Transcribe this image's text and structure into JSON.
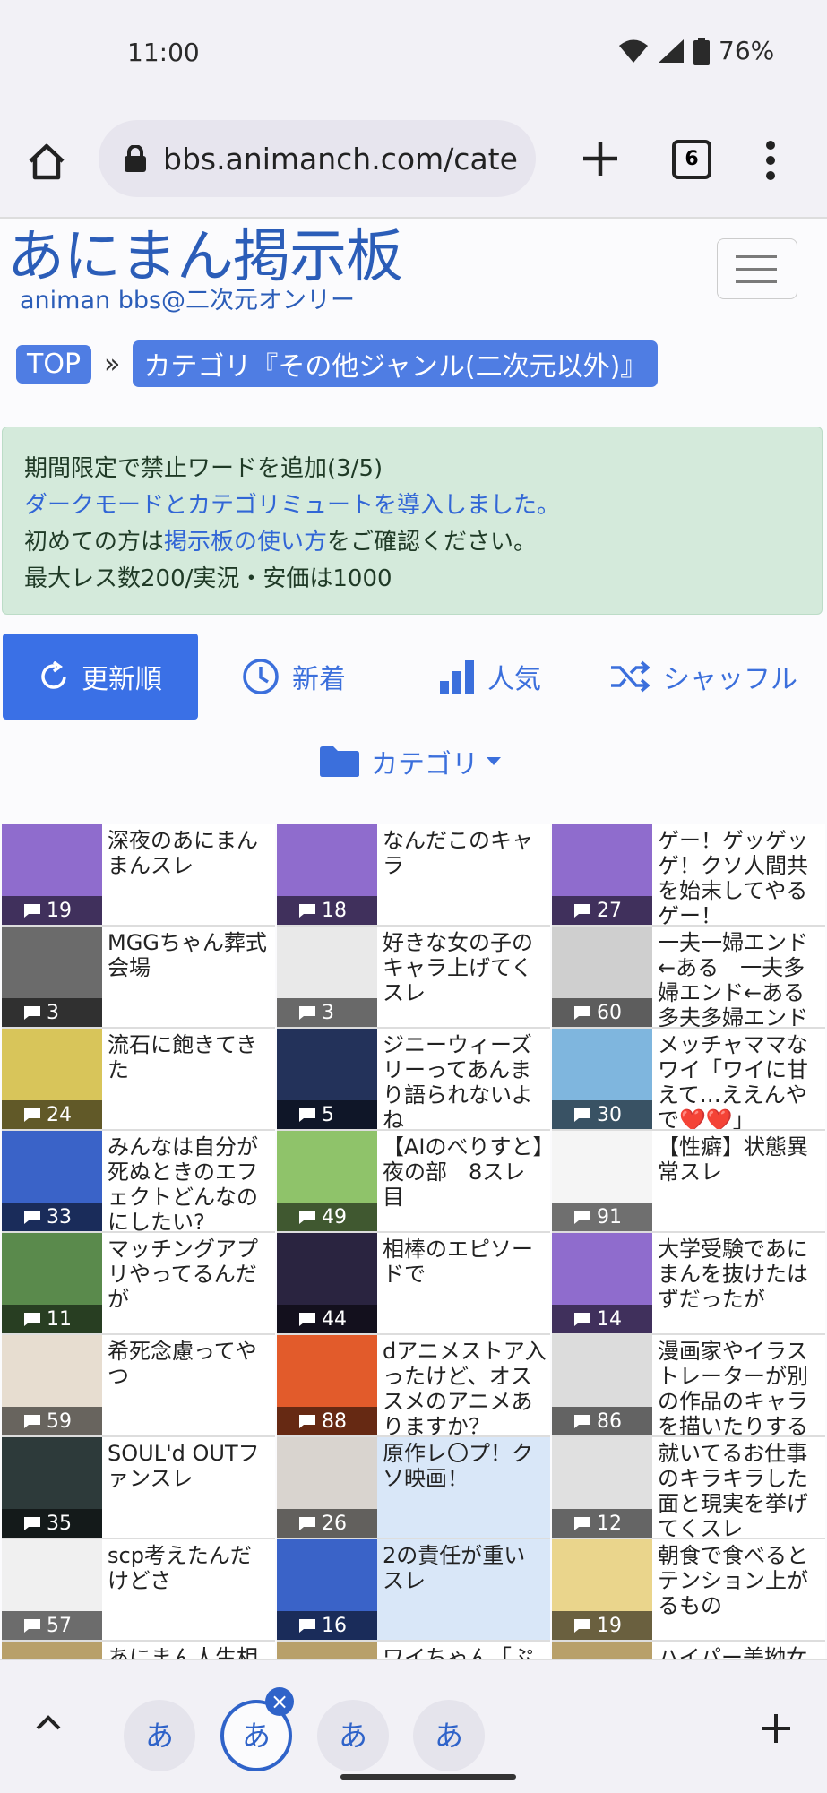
{
  "status": {
    "time": "11:00",
    "battery": "76%"
  },
  "browser": {
    "url": "bbs.animanch.com/cate",
    "tab_count": "6"
  },
  "site": {
    "logo_title": "あにまん掲示板",
    "logo_sub": "animan bbs@二次元オンリー"
  },
  "breadcrumb": {
    "top": "TOP",
    "sep": "»",
    "category": "カテゴリ『その他ジャンル(二次元以外)』"
  },
  "notice": {
    "line1": "期間限定で禁止ワードを追加(3/5)",
    "line2": "ダークモードとカテゴリミュートを導入しました。",
    "line3_pre": "初めての方は",
    "line3_link": "掲示板の使い方",
    "line3_post": "をご確認ください。",
    "line4": "最大レス数200/実況・安価は1000"
  },
  "sort_tabs": {
    "updated": "更新順",
    "new": "新着",
    "popular": "人気",
    "shuffle": "シャッフル"
  },
  "category_button": "カテゴリ",
  "threads": [
    {
      "title": "深夜のあにまんまんスレ",
      "count": "19",
      "thumb": "#8f6ccd"
    },
    {
      "title": "なんだこのキャラ",
      "count": "18",
      "thumb": "#8f6ccd"
    },
    {
      "title": "ゲー！ゲッゲッゲ！クソ人間共を始末してやるゲー！",
      "count": "27",
      "thumb": "#8f6ccd"
    },
    {
      "title": "MGGちゃん葬式会場",
      "count": "3",
      "thumb": "#6b6b6b"
    },
    {
      "title": "好きな女の子のキャラ上げてくスレ",
      "count": "3",
      "thumb": "#e9e9e9"
    },
    {
      "title": "一夫一婦エンド←ある　一夫多婦エンド←ある　多夫多婦エンド",
      "count": "60",
      "thumb": "#cfcfcf"
    },
    {
      "title": "流石に飽きてきた",
      "count": "24",
      "thumb": "#d8c55a"
    },
    {
      "title": "ジニーウィーズリーってあんまり語られないよね",
      "count": "5",
      "thumb": "#23325a"
    },
    {
      "title": "メッチャママなワイ「ワイに甘えて…ええんやで❤️❤️」",
      "count": "30",
      "thumb": "#7fb6de"
    },
    {
      "title": "みんなは自分が死ぬときのエフェクトどんなのにしたい?",
      "count": "33",
      "thumb": "#3a63c8"
    },
    {
      "title": "【AIのべりすと】夜の部　8スレ目",
      "count": "49",
      "thumb": "#8fc36a"
    },
    {
      "title": "【性癖】状態異常スレ",
      "count": "91",
      "thumb": "#f5f5f5"
    },
    {
      "title": "マッチングアプリやってるんだが",
      "count": "11",
      "thumb": "#5a8a4c"
    },
    {
      "title": "相棒のエピソードで",
      "count": "44",
      "thumb": "#2a2440"
    },
    {
      "title": "大学受験であにまんを抜けたはずだったが",
      "count": "14",
      "thumb": "#8f6ccd"
    },
    {
      "title": "希死念慮ってやつ",
      "count": "59",
      "thumb": "#e7ddd0"
    },
    {
      "title": "dアニメストア入ったけど、オススメのアニメありますか？",
      "count": "88",
      "thumb": "#e25b2b"
    },
    {
      "title": "漫画家やイラストレーターが別の作品のキャラを描いたりする",
      "count": "86",
      "thumb": "#dcdcdc"
    },
    {
      "title": "SOUL'd OUTファンスレ",
      "count": "35",
      "thumb": "#2d3a3a"
    },
    {
      "title": "原作レ〇プ！クソ映画！",
      "count": "26",
      "thumb": "#d9d4cf"
    },
    {
      "title": "就いてるお仕事のキラキラした面と現実を挙げてくスレ",
      "count": "12",
      "thumb": "#e0e0e0"
    },
    {
      "title": "scp考えたんだけどさ",
      "count": "57",
      "thumb": "#f0f0f0"
    },
    {
      "title": "2の責任が重いスレ",
      "count": "16",
      "thumb": "#3a63c8"
    },
    {
      "title": "朝食で食べるとテンション上がるもの",
      "count": "19",
      "thumb": "#ead58c"
    }
  ],
  "partial_row": [
    "あにまん人生相",
    "ワイちゃん「ぷ",
    "ハイパー美拗女"
  ],
  "bottom_tabs": [
    "あ",
    "あ",
    "あ",
    "あ"
  ]
}
